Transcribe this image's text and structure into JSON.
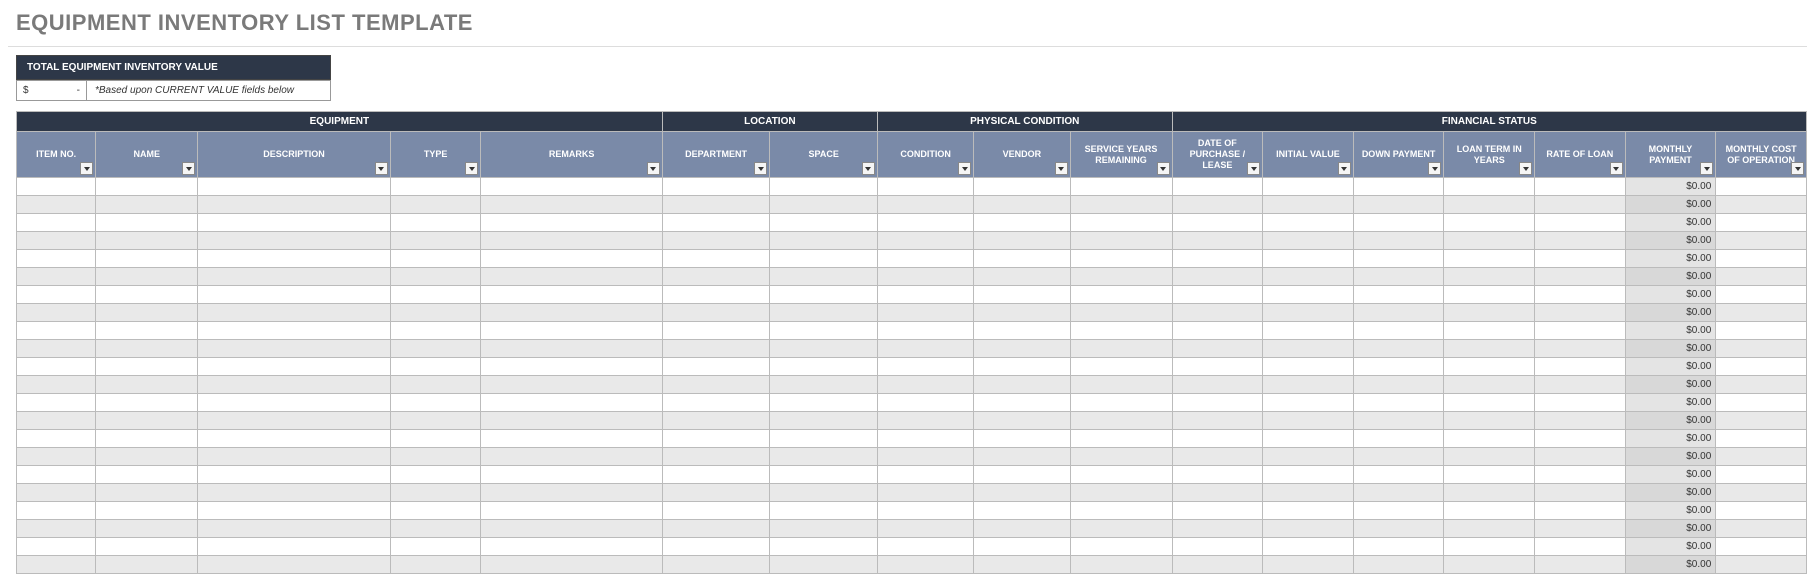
{
  "title": "EQUIPMENT INVENTORY LIST TEMPLATE",
  "summary": {
    "header": "TOTAL EQUIPMENT INVENTORY VALUE",
    "currency": "$",
    "value": "-",
    "note": "*Based upon CURRENT VALUE fields below"
  },
  "groups": [
    {
      "label": "EQUIPMENT",
      "span": 5
    },
    {
      "label": "LOCATION",
      "span": 2
    },
    {
      "label": "PHYSICAL CONDITION",
      "span": 3
    },
    {
      "label": "FINANCIAL STATUS",
      "span": 7
    }
  ],
  "columns": [
    "ITEM NO.",
    "NAME",
    "DESCRIPTION",
    "TYPE",
    "REMARKS",
    "DEPARTMENT",
    "SPACE",
    "CONDITION",
    "VENDOR",
    "SERVICE YEARS REMAINING",
    "DATE OF PURCHASE / LEASE",
    "INITIAL VALUE",
    "DOWN PAYMENT",
    "LOAN TERM IN YEARS",
    "RATE OF LOAN",
    "MONTHLY PAYMENT",
    "MONTHLY COST OF OPERATION"
  ],
  "monthly_payment_default": "$0.00",
  "row_count": 22
}
